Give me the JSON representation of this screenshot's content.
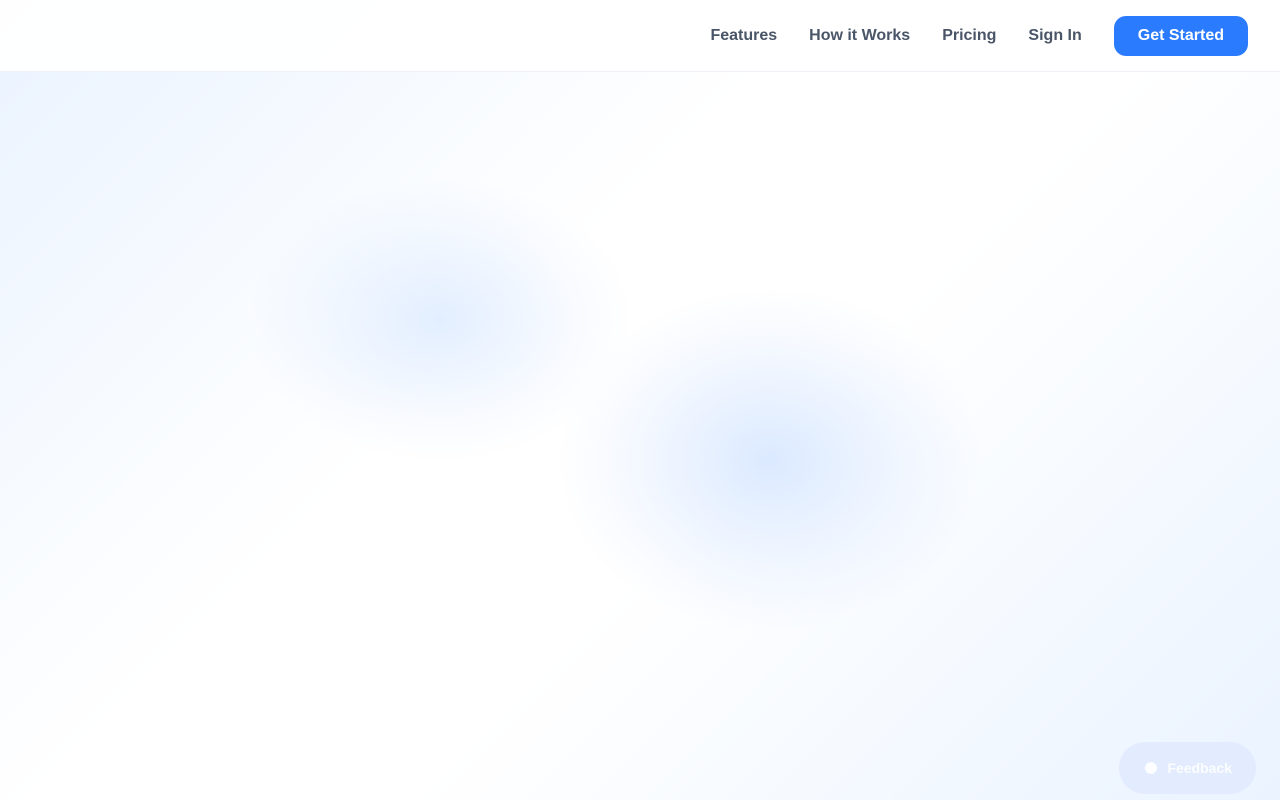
{
  "nav": {
    "links": [
      {
        "label": "Features"
      },
      {
        "label": "How it Works"
      },
      {
        "label": "Pricing"
      },
      {
        "label": "Sign In"
      }
    ],
    "cta_label": "Get Started"
  },
  "feedback": {
    "label": "Feedback",
    "icon": "chat-bubble-icon"
  },
  "colors": {
    "accent": "#2b7bff",
    "nav_text": "#4a5568",
    "feedback_bg": "#e2ecfe"
  }
}
